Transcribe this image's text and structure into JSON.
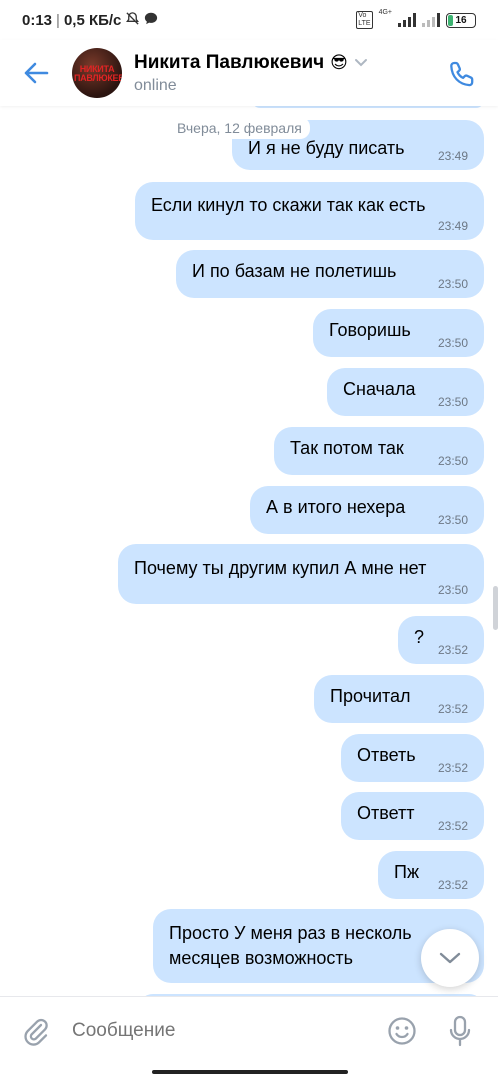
{
  "status_bar": {
    "time": "0:13",
    "speed": "0,5 КБ/с",
    "battery": "16",
    "network": "4G+",
    "volte": "VoLTE"
  },
  "header": {
    "name": "Никита Павлюкевич",
    "emoji": "😎",
    "status": "online",
    "avatar_text": "НИКИТА ПАВЛЮКЕВИЧ"
  },
  "date_separator": "Вчера, 12 февраля",
  "messages": [
    {
      "text": "",
      "time": ""
    },
    {
      "text": "И я не буду писать",
      "time": "23:49"
    },
    {
      "text": "Если кинул то скажи так как есть",
      "time": "23:49"
    },
    {
      "text": "И по базам не полетишь",
      "time": "23:50"
    },
    {
      "text": "Говоришь",
      "time": "23:50"
    },
    {
      "text": "Сначала",
      "time": "23:50"
    },
    {
      "text": "Так потом так",
      "time": "23:50"
    },
    {
      "text": "А в итого нехера",
      "time": "23:50"
    },
    {
      "text": "Почему ты другим купил А мне нет",
      "time": "23:50"
    },
    {
      "text": "?",
      "time": "23:52"
    },
    {
      "text": "Прочитал",
      "time": "23:52"
    },
    {
      "text": "Ответь",
      "time": "23:52"
    },
    {
      "text": "Ответт",
      "time": "23:52"
    },
    {
      "text": "Пж",
      "time": "23:52"
    },
    {
      "text": "Просто У меня раз в несколько месяцев возможность",
      "line1": "Просто У меня раз в несколь",
      "line2": "месяцев возможность",
      "time": ""
    },
    {
      "text": "",
      "time": ""
    }
  ],
  "composer": {
    "placeholder": "Сообщение"
  },
  "colors": {
    "bubble_out": "#cce4ff",
    "accent": "#3f8ae0",
    "secondary_text": "#818c99"
  },
  "icons": [
    "back-arrow-icon",
    "chevron-down-icon",
    "phone-icon",
    "paperclip-icon",
    "sticker-icon",
    "microphone-icon",
    "jump-down-icon"
  ]
}
